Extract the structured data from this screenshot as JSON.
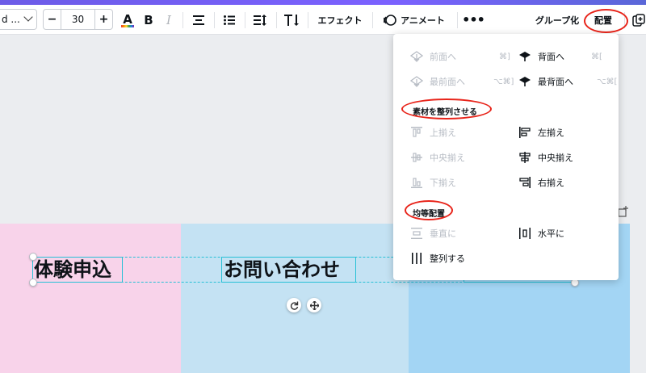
{
  "toolbar": {
    "font_name": "d ...",
    "font_size": "30",
    "minus": "−",
    "plus": "+",
    "color_label": "A",
    "bold_label": "B",
    "italic_label": "I",
    "effects_label": "エフェクト",
    "animate_label": "アニメート",
    "more_label": "•••",
    "group_label": "グループ化",
    "arrange_label": "配置"
  },
  "canvas": {
    "text1": "体験申込",
    "text2": "お問い合わせ",
    "colors": {
      "left": "#f8d3ea",
      "mid": "#c4e2f3",
      "right": "#a3d5f4",
      "selection": "#27c0d6"
    }
  },
  "panel": {
    "layer": [
      {
        "label": "前面へ",
        "shortcut": "⌘]",
        "enabled": false
      },
      {
        "label": "背面へ",
        "shortcut": "⌘[",
        "enabled": true
      },
      {
        "label": "最前面へ",
        "shortcut": "⌥⌘]",
        "enabled": false
      },
      {
        "label": "最背面へ",
        "shortcut": "⌥⌘[",
        "enabled": true
      }
    ],
    "align_title": "素材を整列させる",
    "align": [
      {
        "label": "上揃え",
        "enabled": false
      },
      {
        "label": "左揃え",
        "enabled": true
      },
      {
        "label": "中央揃え",
        "enabled": false
      },
      {
        "label": "中央揃え",
        "enabled": true
      },
      {
        "label": "下揃え",
        "enabled": false
      },
      {
        "label": "右揃え",
        "enabled": true
      }
    ],
    "distribute_title": "均等配置",
    "distribute": [
      {
        "label": "垂直に",
        "enabled": false
      },
      {
        "label": "水平に",
        "enabled": true
      },
      {
        "label": "整列する",
        "enabled": true
      }
    ]
  },
  "annotation_color": "#e8241a"
}
